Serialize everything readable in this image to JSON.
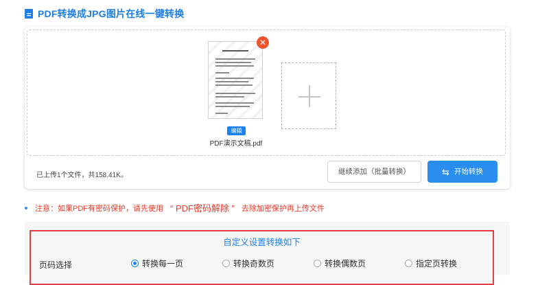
{
  "header": {
    "title": "PDF转换成JPG图片在线一键转换",
    "icon": "document-icon"
  },
  "upload": {
    "file": {
      "name": "PDF演示文稿.pdf",
      "edit_label": "编辑",
      "remove_icon": "close-icon"
    },
    "add_icon": "plus-icon",
    "status": "已上传1个文件，共158.41K。",
    "continue_label": "继续添加（批量转换）",
    "start_label": "开始转换",
    "start_icon": "swap-arrows-icon"
  },
  "notice": {
    "prefix": "注意：如果PDF有密码保护，请先使用",
    "link": "“ PDF密码解除 ”",
    "suffix": "去除加密保护再上传文件"
  },
  "settings": {
    "title": "自定义设置转换如下",
    "page_label": "页码选择",
    "options": [
      {
        "label": "转换每一页",
        "checked": true
      },
      {
        "label": "转换奇数页",
        "checked": false
      },
      {
        "label": "转换偶数页",
        "checked": false
      },
      {
        "label": "指定页转换",
        "checked": false
      }
    ]
  },
  "colors": {
    "accent": "#1a82ee",
    "warning": "#e53a2c",
    "remove": "#f0542d"
  }
}
